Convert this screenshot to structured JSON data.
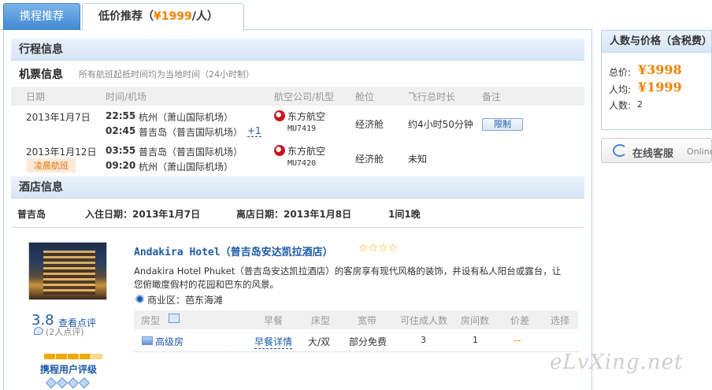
{
  "tabs": {
    "recommend": "携程推荐",
    "low_price_label": "低价推荐（",
    "low_price_value": "¥1999",
    "low_price_suffix": "/人）"
  },
  "itinerary": {
    "section_title": "行程信息",
    "flight_title": "机票信息",
    "flight_note": "所有航班起抵时间均为当地时间（24小时制）",
    "headers": {
      "date": "日期",
      "time": "时间/机场",
      "airline": "航空公司/机型",
      "cabin": "舱位",
      "duration": "飞行总时长",
      "remark": "备注"
    },
    "flights": [
      {
        "date": "2013年1月7日",
        "dep_time": "22:55",
        "dep_airport": "杭州（萧山国际机场）",
        "arr_time": "02:45",
        "arr_airport": "普吉岛（普吉国际机场）",
        "plus_day": "+1",
        "airline": "东方航空",
        "flight_no": "MU7419",
        "cabin": "经济舱",
        "duration": "约4小时50分钟",
        "remark": "限制"
      },
      {
        "date": "2013年1月12日",
        "tag": "凌晨航班",
        "dep_time": "03:55",
        "dep_airport": "普吉岛（普吉国际机场）",
        "arr_time": "09:20",
        "arr_airport": "杭州（萧山国际机场）",
        "airline": "东方航空",
        "flight_no": "MU7420",
        "cabin": "经济舱",
        "duration": "未知"
      }
    ]
  },
  "hotel": {
    "section_title": "酒店信息",
    "city": "普吉岛",
    "checkin_label": "入住日期：",
    "checkin": "2013年1月7日",
    "checkout_label": "离店日期：",
    "checkout": "2013年1月8日",
    "rooms_nights": "1间1晚",
    "name": "Andakira Hotel（普吉岛安达凯拉酒店）",
    "stars": "☆☆☆☆",
    "description_line1": "Andakira Hotel Phuket（普吉岛安达凯拉酒店）的客房享有现代风格的装饰，并设有私人阳台或露台，让",
    "description_line2": "您俯瞰度假村的花园和巴东的风景。",
    "district": "商业区：芭东海滩",
    "score": "3.8",
    "review_link": "查看点评",
    "review_count": "(2人点评)",
    "user_rating_label": "携程用户评级",
    "rating_fraction": 0.75,
    "room_headers": {
      "type": "房型",
      "breakfast": "早餐",
      "bed": "床型",
      "broadband": "宽带",
      "adults": "可住成人数",
      "rooms": "房间数",
      "diff": "价差",
      "select": "选择"
    },
    "room": {
      "type": "高级房",
      "breakfast": "早餐详情",
      "bed": "大/双",
      "broadband": "部分免费",
      "adults": "3",
      "rooms": "1",
      "diff": "--"
    }
  },
  "price_panel": {
    "title": "人数与价格（含税费）",
    "total_label": "总价:",
    "total_value": "¥3998",
    "per_label": "人均:",
    "per_value": "¥1999",
    "count_label": "人数:",
    "count_value": "2"
  },
  "service": {
    "label": "在线客服",
    "label_en": "Online"
  },
  "watermark": "eLvXing.net",
  "colors": {
    "accent_orange": "#f08300",
    "link_blue": "#1e5aa8",
    "tab_blue": "#3f88d4"
  }
}
